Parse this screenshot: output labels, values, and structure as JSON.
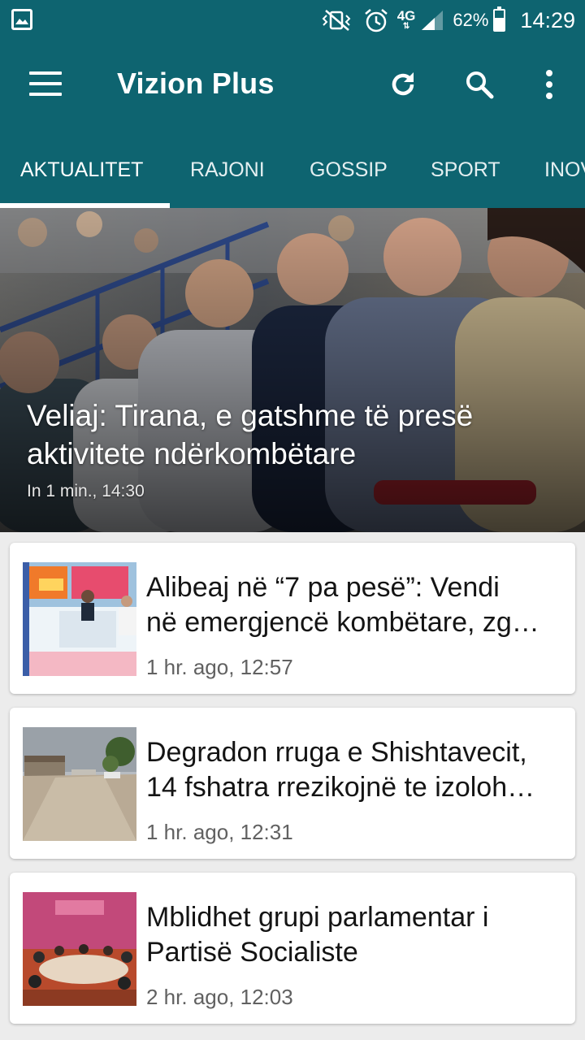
{
  "status_bar": {
    "network": "4G",
    "battery": "62%",
    "battery_level": 0.62,
    "time": "14:29"
  },
  "toolbar": {
    "title": "Vizion Plus",
    "icons": [
      "menu-icon",
      "refresh-icon",
      "search-icon",
      "more-vert-icon"
    ]
  },
  "tabs": [
    {
      "label": "AKTUALITET",
      "selected": true
    },
    {
      "label": "RAJONI",
      "selected": false
    },
    {
      "label": "GOSSIP",
      "selected": false
    },
    {
      "label": "SPORT",
      "selected": false
    },
    {
      "label": "INOV",
      "selected": false
    }
  ],
  "hero": {
    "title_line1": "Veliaj: Tirana, e gatshme të presë",
    "title_line2": "aktivitete ndërkombëtare",
    "meta": "In 1 min., 14:30"
  },
  "articles": [
    {
      "title_line1": "Alibeaj në “7 pa pesë”: Vendi",
      "title_line2": "në emergjencë kombëtare, zg…",
      "meta": "1 hr. ago, 12:57"
    },
    {
      "title_line1": "Degradon rruga e Shishtavecit,",
      "title_line2": "14 fshatra rrezikojnë te izoloh…",
      "meta": "1 hr. ago, 12:31"
    },
    {
      "title_line1": "Mblidhet grupi parlamentar i",
      "title_line2": "Partisë Socialiste",
      "meta": "2 hr. ago, 12:03"
    }
  ],
  "colors": {
    "primary": "#0e6470",
    "tab_indicator": "#ffffff",
    "background": "#ececec"
  }
}
